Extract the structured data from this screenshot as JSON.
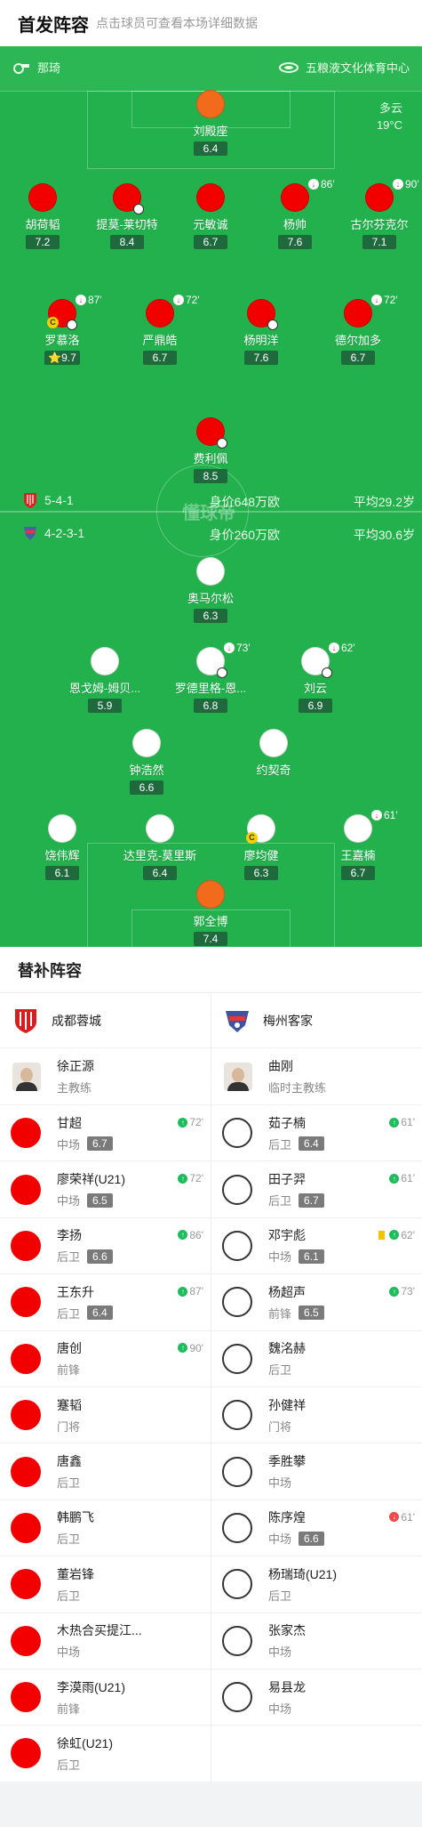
{
  "header": {
    "title": "首发阵容",
    "subtitle": "点击球员可查看本场详细数据"
  },
  "pitch": {
    "referee": "那琦",
    "venue": "五粮液文化体育中心",
    "weather": "多云",
    "temperature": "19°C",
    "watermark": "懂球帝",
    "home_formation": {
      "formation": "5-4-1",
      "value": "身价648万欧",
      "avg_age": "平均29.2岁"
    },
    "away_formation": {
      "formation": "4-2-3-1",
      "value": "身价260万欧",
      "avg_age": "平均30.6岁"
    }
  },
  "home_starters": [
    {
      "name": "刘殿座",
      "rating": "6.4",
      "color": "#f26a1b"
    },
    {
      "name": "胡荷韬",
      "rating": "7.2",
      "color": "#f20000"
    },
    {
      "name": "提莫-莱切特",
      "rating": "8.4",
      "color": "#f20000"
    },
    {
      "name": "元敏诚",
      "rating": "6.7",
      "color": "#f20000"
    },
    {
      "name": "杨帅",
      "rating": "7.6",
      "color": "#f20000",
      "sub_time": "86'"
    },
    {
      "name": "古尔芬克尔",
      "rating": "7.1",
      "color": "#f20000",
      "sub_time": "90'"
    },
    {
      "name": "罗慕洛",
      "rating": "9.7",
      "color": "#f20000",
      "sub_time": "87'"
    },
    {
      "name": "严鼎皓",
      "rating": "6.7",
      "color": "#f20000",
      "sub_time": "72'"
    },
    {
      "name": "杨明洋",
      "rating": "7.6",
      "color": "#f20000"
    },
    {
      "name": "德尔加多",
      "rating": "6.7",
      "color": "#f20000",
      "sub_time": "72'"
    },
    {
      "name": "费利佩",
      "rating": "8.5",
      "color": "#f20000"
    }
  ],
  "away_starters": [
    {
      "name": "奥马尔松",
      "rating": "6.3",
      "color": "#ffffff"
    },
    {
      "name": "恩戈姆-姆贝...",
      "rating": "5.9",
      "color": "#ffffff"
    },
    {
      "name": "罗德里格-恩...",
      "rating": "6.8",
      "color": "#ffffff",
      "sub_time": "73'"
    },
    {
      "name": "刘云",
      "rating": "6.9",
      "color": "#ffffff",
      "sub_time": "62'"
    },
    {
      "name": "钟浩然",
      "rating": "6.6",
      "color": "#ffffff"
    },
    {
      "name": "约契奇",
      "rating": "",
      "color": "#ffffff"
    },
    {
      "name": "饶伟辉",
      "rating": "6.1",
      "color": "#ffffff"
    },
    {
      "name": "达里克-莫里斯",
      "rating": "6.4",
      "color": "#ffffff"
    },
    {
      "name": "廖均健",
      "rating": "6.3",
      "color": "#ffffff"
    },
    {
      "name": "王嘉楠",
      "rating": "6.7",
      "color": "#ffffff",
      "sub_time": "61'"
    },
    {
      "name": "郭全博",
      "rating": "7.4",
      "color": "#f26a1b"
    }
  ],
  "subs": {
    "title": "替补阵容",
    "home": {
      "team": "成都蓉城",
      "coach": {
        "name": "徐正源",
        "role": "主教练"
      },
      "players": [
        {
          "name": "甘超",
          "pos": "中场",
          "rating": "6.7",
          "time": "72'"
        },
        {
          "name": "廖荣祥(U21)",
          "pos": "中场",
          "rating": "6.5",
          "time": "72'"
        },
        {
          "name": "李扬",
          "pos": "后卫",
          "rating": "6.6",
          "time": "86'"
        },
        {
          "name": "王东升",
          "pos": "后卫",
          "rating": "6.4",
          "time": "87'"
        },
        {
          "name": "唐创",
          "pos": "前锋",
          "rating": "",
          "time": "90'"
        },
        {
          "name": "蹇韬",
          "pos": "门将",
          "rating": "",
          "time": ""
        },
        {
          "name": "唐鑫",
          "pos": "后卫",
          "rating": "",
          "time": ""
        },
        {
          "name": "韩鹏飞",
          "pos": "后卫",
          "rating": "",
          "time": ""
        },
        {
          "name": "董岩锋",
          "pos": "后卫",
          "rating": "",
          "time": ""
        },
        {
          "name": "木热合买提江...",
          "pos": "中场",
          "rating": "",
          "time": ""
        },
        {
          "name": "李漠雨(U21)",
          "pos": "前锋",
          "rating": "",
          "time": ""
        },
        {
          "name": "徐虹(U21)",
          "pos": "后卫",
          "rating": "",
          "time": ""
        }
      ]
    },
    "away": {
      "team": "梅州客家",
      "coach": {
        "name": "曲刚",
        "role": "临时主教练"
      },
      "players": [
        {
          "name": "茹子楠",
          "pos": "后卫",
          "rating": "6.4",
          "time": "61'"
        },
        {
          "name": "田子羿",
          "pos": "后卫",
          "rating": "6.7",
          "time": "61'"
        },
        {
          "name": "邓宇彪",
          "pos": "中场",
          "rating": "6.1",
          "time": "62'",
          "yellow": true
        },
        {
          "name": "杨超声",
          "pos": "前锋",
          "rating": "6.5",
          "time": "73'"
        },
        {
          "name": "魏洺赫",
          "pos": "后卫",
          "rating": "",
          "time": ""
        },
        {
          "name": "孙健祥",
          "pos": "门将",
          "rating": "",
          "time": ""
        },
        {
          "name": "季胜攀",
          "pos": "中场",
          "rating": "",
          "time": ""
        },
        {
          "name": "陈序煌",
          "pos": "中场",
          "rating": "6.6",
          "time": "61'",
          "out": true
        },
        {
          "name": "杨瑞琦(U21)",
          "pos": "后卫",
          "rating": "",
          "time": ""
        },
        {
          "name": "张家杰",
          "pos": "中场",
          "rating": "",
          "time": ""
        },
        {
          "name": "易县龙",
          "pos": "中场",
          "rating": "",
          "time": ""
        }
      ]
    }
  }
}
